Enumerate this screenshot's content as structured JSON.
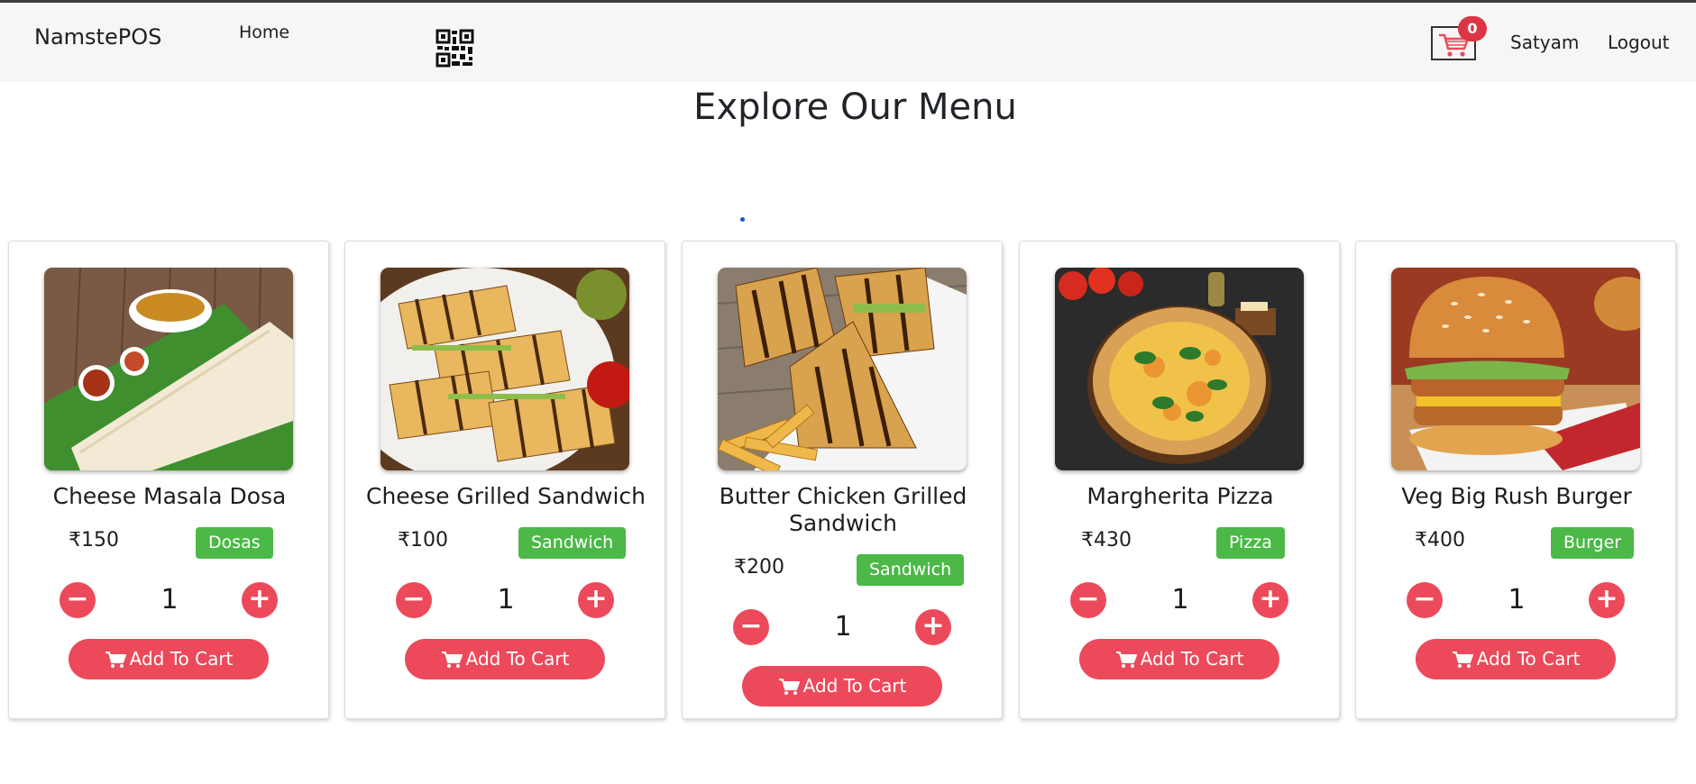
{
  "navbar": {
    "brand": "NamstePOS",
    "home_label": "Home",
    "cart_count": "0",
    "user_name": "Satyam",
    "logout_label": "Logout"
  },
  "page_title": "Explore Our Menu",
  "accent_color": "#ec4a5a",
  "badge_color": "#4cb848",
  "cards": [
    {
      "name": "Cheese Masala Dosa",
      "price": "₹150",
      "category": "Dosas",
      "quantity": "1",
      "add_label": "Add To Cart",
      "image": "masala-dosa-photo"
    },
    {
      "name": "Cheese Grilled Sandwich",
      "price": "₹100",
      "category": "Sandwich",
      "quantity": "1",
      "add_label": "Add To Cart",
      "image": "grilled-sandwich-photo"
    },
    {
      "name": "Butter Chicken Grilled Sandwich",
      "price": "₹200",
      "category": "Sandwich",
      "quantity": "1",
      "add_label": "Add To Cart",
      "image": "chicken-sandwich-fries-photo"
    },
    {
      "name": "Margherita Pizza",
      "price": "₹430",
      "category": "Pizza",
      "quantity": "1",
      "add_label": "Add To Cart",
      "image": "margherita-pizza-photo"
    },
    {
      "name": "Veg Big Rush Burger",
      "price": "₹400",
      "category": "Burger",
      "quantity": "1",
      "add_label": "Add To Cart",
      "image": "veg-burger-photo"
    }
  ]
}
